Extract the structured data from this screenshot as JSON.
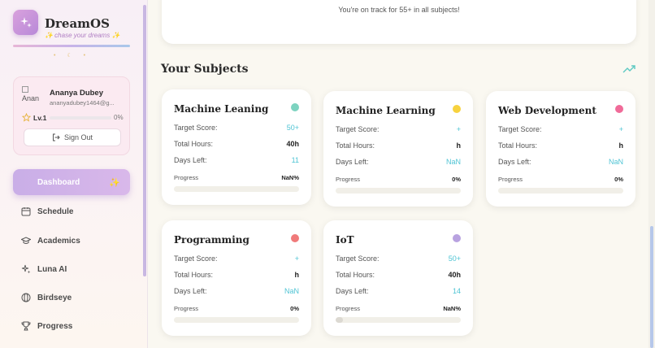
{
  "app": {
    "name": "DreamOS",
    "tagline": "✨ chase your dreams ✨",
    "dots": "• ☾ •"
  },
  "user": {
    "avatar_alt": "Anan",
    "name": "Ananya Dubey",
    "email": "ananyadubey1464@g...",
    "level": "Lv.1",
    "level_progress": 0,
    "level_pct": "0%",
    "sign_out": "Sign Out"
  },
  "nav": {
    "items": [
      {
        "label": "Dashboard",
        "icon": "dashboard",
        "active": true
      },
      {
        "label": "Schedule",
        "icon": "calendar-icon"
      },
      {
        "label": "Academics",
        "icon": "graduation-cap-icon"
      },
      {
        "label": "Luna AI",
        "icon": "sparkles-icon"
      },
      {
        "label": "Birdseye",
        "icon": "globe-icon"
      },
      {
        "label": "Progress",
        "icon": "trophy-icon"
      }
    ]
  },
  "banner": {
    "text": "You're on track for 55+ in all subjects!"
  },
  "subjects": {
    "title": "Your Subjects",
    "labels": {
      "target": "Target Score:",
      "hours": "Total Hours:",
      "days": "Days Left:",
      "progress": "Progress"
    },
    "cards": [
      {
        "name": "Machine Leaning",
        "color": "#7dd3c0",
        "target": "50+",
        "hours": "40h",
        "days": "11",
        "progress": "NaN%",
        "fill": 0
      },
      {
        "name": "Machine Learning",
        "color": "#f7d23e",
        "target": "+",
        "hours": "h",
        "days": "NaN",
        "progress": "0%",
        "fill": 0
      },
      {
        "name": "Web Development",
        "color": "#f06b99",
        "target": "+",
        "hours": "h",
        "days": "NaN",
        "progress": "0%",
        "fill": 0
      },
      {
        "name": "Programming",
        "color": "#f07a7a",
        "target": "+",
        "hours": "h",
        "days": "NaN",
        "progress": "0%",
        "fill": 0
      },
      {
        "name": "IoT",
        "color": "#b8a2e0",
        "target": "50+",
        "hours": "40h",
        "days": "14",
        "progress": "NaN%",
        "fill": 0.06
      }
    ]
  }
}
